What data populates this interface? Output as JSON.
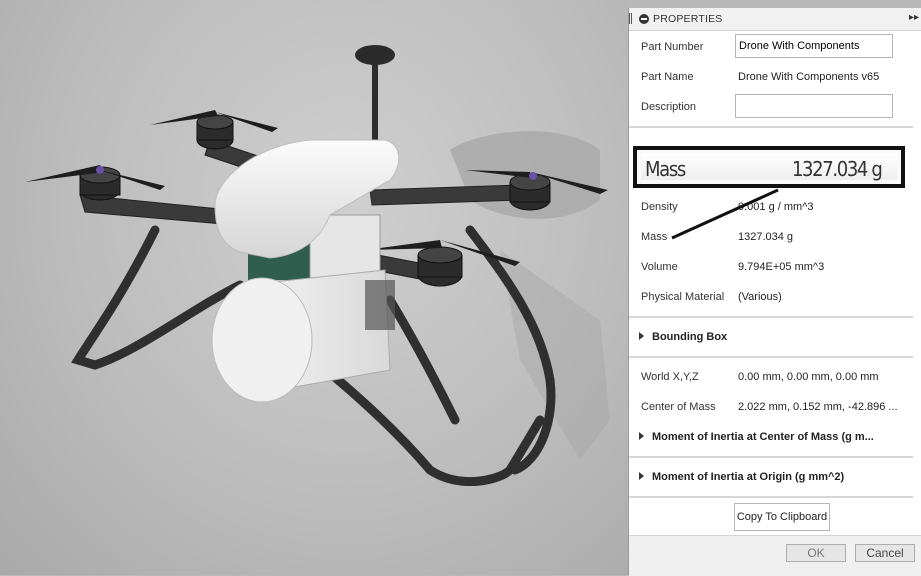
{
  "panel": {
    "title": "PROPERTIES",
    "fields": {
      "part_number_label": "Part Number",
      "part_number_value": "Drone With Components",
      "part_name_label": "Part Name",
      "part_name_value": "Drone With Components v65",
      "description_label": "Description",
      "description_value": ""
    },
    "highlight": {
      "label": "Mass",
      "value": "1327.034 g"
    },
    "physical": {
      "density_label": "Density",
      "density_value": "0.001 g / mm^3",
      "mass_label": "Mass",
      "mass_value": "1327.034 g",
      "volume_label": "Volume",
      "volume_value": "9.794E+05 mm^3",
      "material_label": "Physical Material",
      "material_value": "(Various)"
    },
    "bounding_box": {
      "title": "Bounding Box"
    },
    "location": {
      "world_label": "World X,Y,Z",
      "world_value": "0.00 mm, 0.00 mm, 0.00 mm",
      "com_label": "Center of Mass",
      "com_value": "2.022 mm, 0.152 mm, -42.896 ..."
    },
    "sections": {
      "moi_com": "Moment of Inertia at Center of Mass   (g m...",
      "moi_origin": "Moment of Inertia at Origin   (g mm^2)"
    },
    "buttons": {
      "copy": "Copy To Clipboard",
      "ok": "OK",
      "cancel": "Cancel"
    }
  },
  "icons": {
    "collapse": "minus-circle-icon",
    "expand": "double-chevron-right-icon",
    "section_toggle": "triangle-right-icon"
  }
}
